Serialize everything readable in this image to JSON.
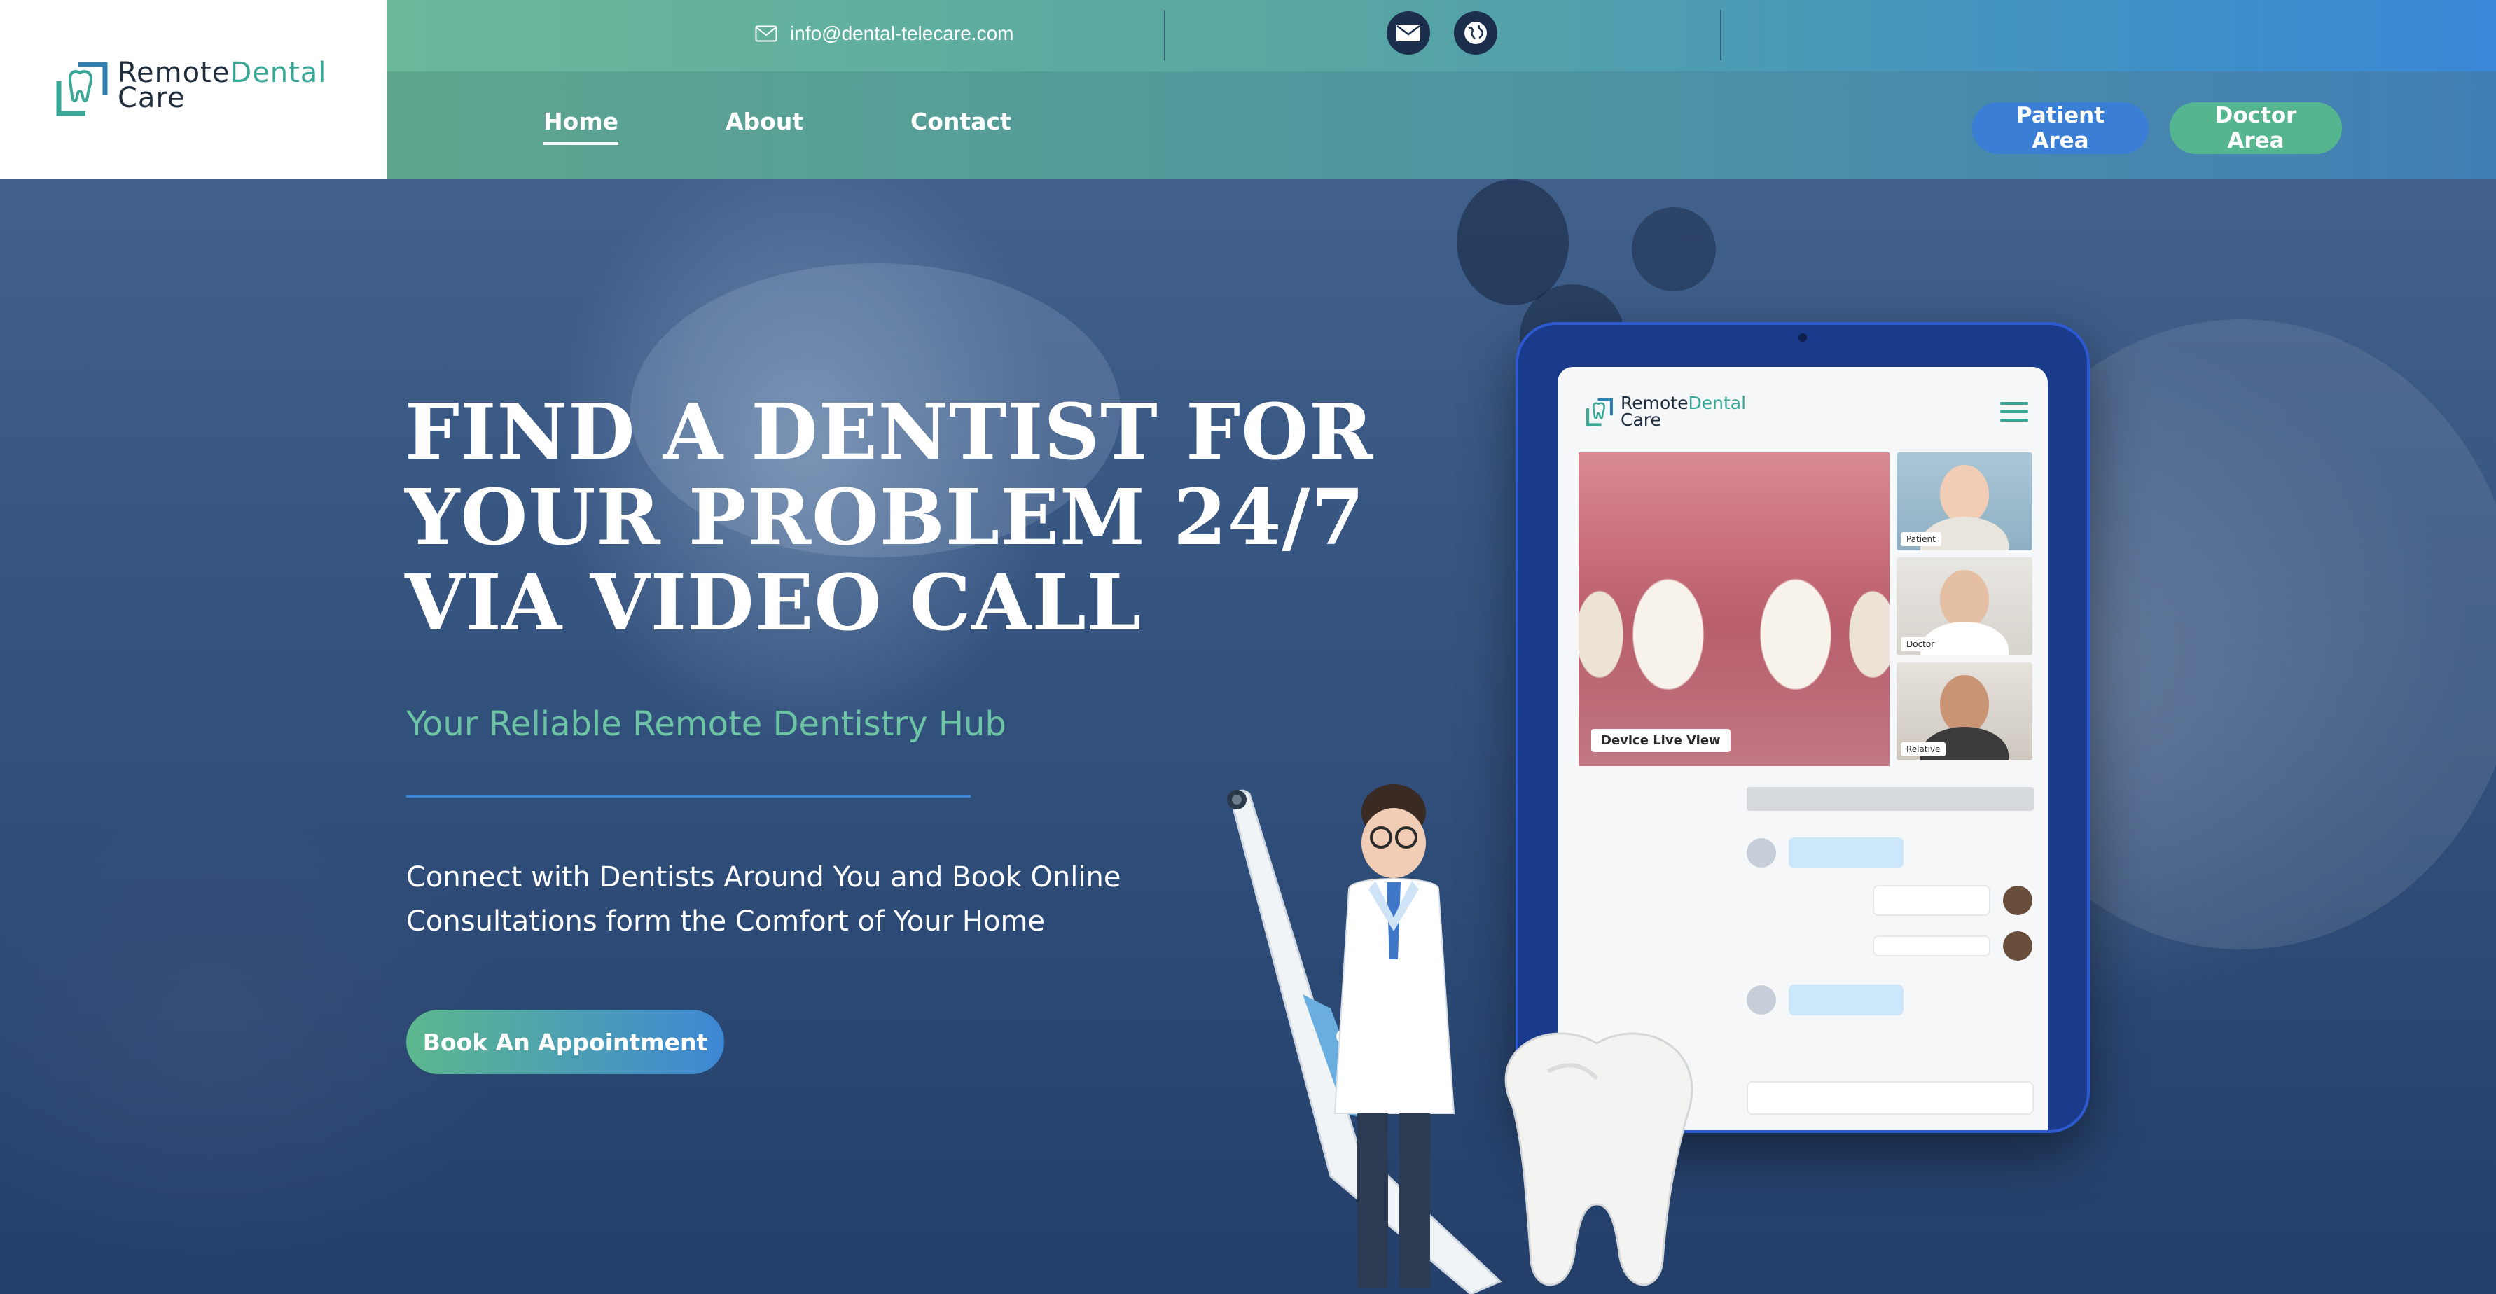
{
  "brand": {
    "name_part1": "Remote",
    "name_part2": "Dental",
    "name_line2": "Care",
    "accent_color": "#3aa796",
    "icon": "tooth-logo-icon"
  },
  "topbar": {
    "email": "info@dental-telecare.com",
    "email_icon": "envelope-icon",
    "social_icons": [
      "mail-icon",
      "globe-icon"
    ]
  },
  "nav": {
    "links": [
      {
        "label": "Home",
        "active": true
      },
      {
        "label": "About",
        "active": false
      },
      {
        "label": "Contact",
        "active": false
      }
    ],
    "patient_button": "Patient Area",
    "doctor_button": "Doctor Area"
  },
  "hero": {
    "title_line1": "FIND A DENTIST FOR",
    "title_line2": "YOUR PROBLEM 24/7",
    "title_line3": "VIA VIDEO CALL",
    "subtitle": "Your Reliable Remote Dentistry Hub",
    "body_line1": "Connect with Dentists Around You and Book Online",
    "body_line2": "Consultations form the Comfort of Your Home",
    "cta_label": "Book An Appointment"
  },
  "tablet": {
    "logo_part1": "Remote",
    "logo_part2": "Dental",
    "logo_line2": "Care",
    "menu_icon": "hamburger-menu-icon",
    "live_view_label": "Device Live View",
    "cameras": [
      {
        "label": "Patient"
      },
      {
        "label": "Doctor"
      },
      {
        "label": "Relative"
      }
    ]
  },
  "colors": {
    "topbar_start": "#6ab89a",
    "topbar_end": "#3b86d6",
    "patient_button": "#3b7ed6",
    "doctor_button": "#55b58f",
    "subtitle": "#6cc4a4",
    "hero_rule": "#3b86d6"
  }
}
